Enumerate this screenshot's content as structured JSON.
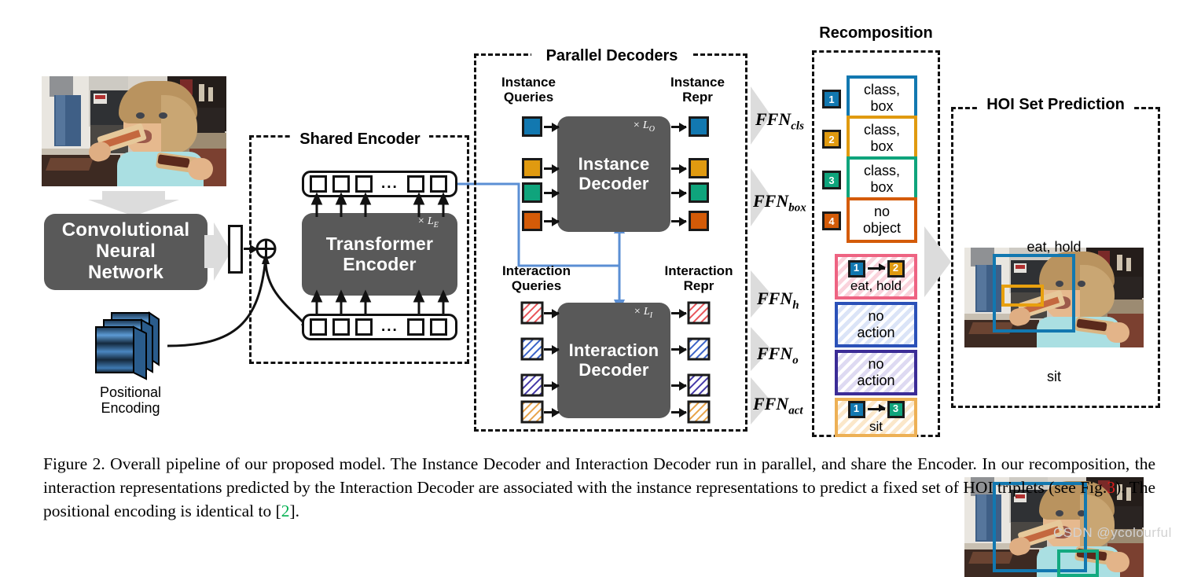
{
  "figure": {
    "pipeline_stages": {
      "cnn_label": "Convolutional\nNeural\nNetwork",
      "cnn_line1": "Convolutional",
      "cnn_line2": "Neural",
      "cnn_line3": "Network",
      "positional_encoding_line1": "Positional",
      "positional_encoding_line2": "Encoding"
    },
    "shared_encoder": {
      "title": "Shared Encoder",
      "block_line1": "Transformer",
      "block_line2": "Encoder",
      "repeat_label": "× L",
      "repeat_sub": "E",
      "dots": "..."
    },
    "parallel_decoders": {
      "title": "Parallel Decoders",
      "instance": {
        "queries_line1": "Instance",
        "queries_line2": "Queries",
        "repr_line1": "Instance",
        "repr_line2": "Repr",
        "block_line1": "Instance",
        "block_line2": "Decoder",
        "repeat_label": "× L",
        "repeat_sub": "O",
        "query_colors": [
          "#1278B0",
          "#E09A10",
          "#0FA47C",
          "#D45B08"
        ]
      },
      "interaction": {
        "queries_line1": "Interaction",
        "queries_line2": "Queries",
        "repr_line1": "Interaction",
        "repr_line2": "Repr",
        "block_line1": "Interaction",
        "block_line2": "Decoder",
        "repeat_label": "× L",
        "repeat_sub": "I",
        "query_colors": [
          "#E8555B",
          "#3A63C8",
          "#4438A8",
          "#E8A44A"
        ]
      }
    },
    "ffn_heads": [
      {
        "name": "FFN",
        "sub": "cls"
      },
      {
        "name": "FFN",
        "sub": "box"
      },
      {
        "name": "FFN",
        "sub": "h"
      },
      {
        "name": "FFN",
        "sub": "o"
      },
      {
        "name": "FFN",
        "sub": "act"
      }
    ],
    "recomposition": {
      "title": "Recomposition",
      "instances": [
        {
          "index": "1",
          "line1": "class,",
          "line2": "box",
          "color": "#1278B0"
        },
        {
          "index": "2",
          "line1": "class,",
          "line2": "box",
          "color": "#E09A10"
        },
        {
          "index": "3",
          "line1": "class,",
          "line2": "box",
          "color": "#0FA47C"
        },
        {
          "index": "4",
          "line1": "no",
          "line2": "object",
          "color": "#D45B08"
        }
      ],
      "interactions": [
        {
          "border": "#EE6382",
          "hatch": "#f6b8c6",
          "has_pair": true,
          "subject": "1",
          "subject_color": "#1278B0",
          "object": "2",
          "object_color": "#E09A10",
          "label": "eat, hold"
        },
        {
          "border": "#2B51B8",
          "hatch": "#c5d2ef",
          "has_pair": false,
          "line1": "no",
          "line2": "action"
        },
        {
          "border": "#3B2C96",
          "hatch": "#cdc9e8",
          "has_pair": false,
          "line1": "no",
          "line2": "action"
        },
        {
          "border": "#EDB055",
          "hatch": "#f8ddb7",
          "has_pair": true,
          "subject": "1",
          "subject_color": "#1278B0",
          "object": "3",
          "object_color": "#0FA47C",
          "label": "sit"
        }
      ]
    },
    "hoi_prediction": {
      "title": "HOI Set Prediction",
      "results": [
        {
          "caption": "eat, hold",
          "boxes": [
            {
              "color": "#1278B0"
            },
            {
              "color": "#E8A00E"
            }
          ]
        },
        {
          "caption": "sit",
          "boxes": [
            {
              "color": "#1278B0"
            },
            {
              "color": "#13A97F"
            }
          ]
        }
      ]
    },
    "caption": {
      "part1": "Figure 2. Overall pipeline of our proposed model. The Instance Decoder and Interaction Decoder run in parallel, and share the Encoder. In our recomposition, the interaction representations predicted by the Interaction Decoder are associated with the instance representations to predict a fixed set of HOI triplets (see Fig.",
      "ref1": "3",
      "part2": "). The positional encoding is identical to [",
      "ref2": "2",
      "part3": "]."
    },
    "watermark": "CSDN @ycolourful"
  }
}
